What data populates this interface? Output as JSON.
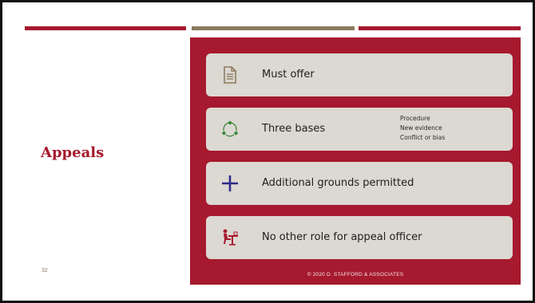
{
  "slide": {
    "title": "Appeals",
    "page_number": "32",
    "footer": "© 2020 D. STAFFORD & ASSOCIATES"
  },
  "cards": [
    {
      "label": "Must offer",
      "icon": "document-icon"
    },
    {
      "label": "Three bases",
      "icon": "cycle-icon",
      "sub_items": [
        "Procedure",
        "New evidence",
        "Conflict or bias"
      ]
    },
    {
      "label": "Additional grounds permitted",
      "icon": "plus-icon"
    },
    {
      "label": "No other role for appeal officer",
      "icon": "desk-person-icon"
    }
  ],
  "colors": {
    "accent": "#a6192e",
    "bar_mid": "#8c7b5e",
    "card_bg": "#dcd8d2",
    "icon_brown": "#8c7b5e",
    "icon_green": "#3c8a3c",
    "icon_navy": "#2e2a8a",
    "icon_red": "#a6192e"
  }
}
